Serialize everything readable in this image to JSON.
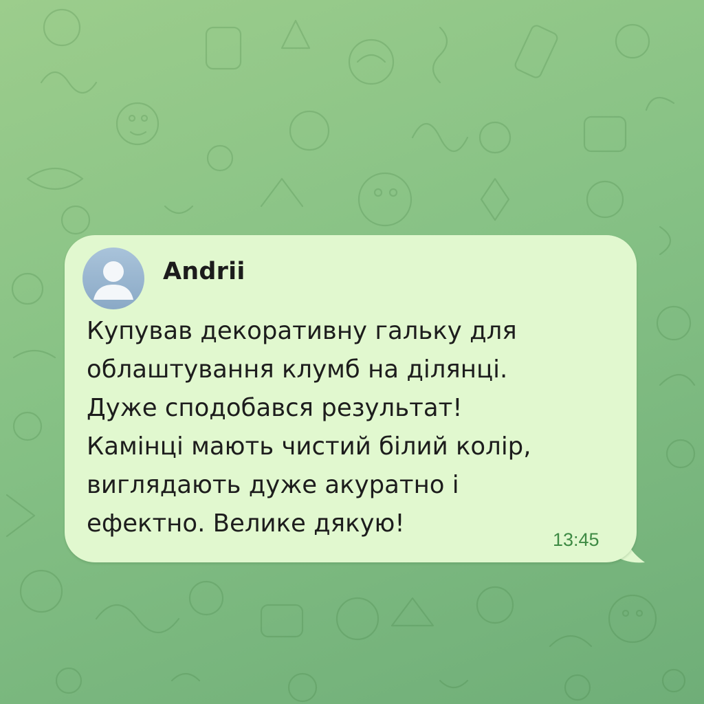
{
  "chat": {
    "background_color": "#8cc686",
    "bubble_color": "#e1f8cf"
  },
  "message": {
    "sender_name": "Andrii",
    "avatar_icon": "user-avatar-icon",
    "text_lines": [
      "Купував декоративну гальку для",
      "облаштування клумб на ділянці.",
      "Дуже сподобався результат!",
      "Камінці мають чистий білий колір,",
      "виглядають дуже акуратно і",
      "ефектно. Велике дякую!"
    ],
    "time": "13:45",
    "time_color": "#3e8a44"
  }
}
